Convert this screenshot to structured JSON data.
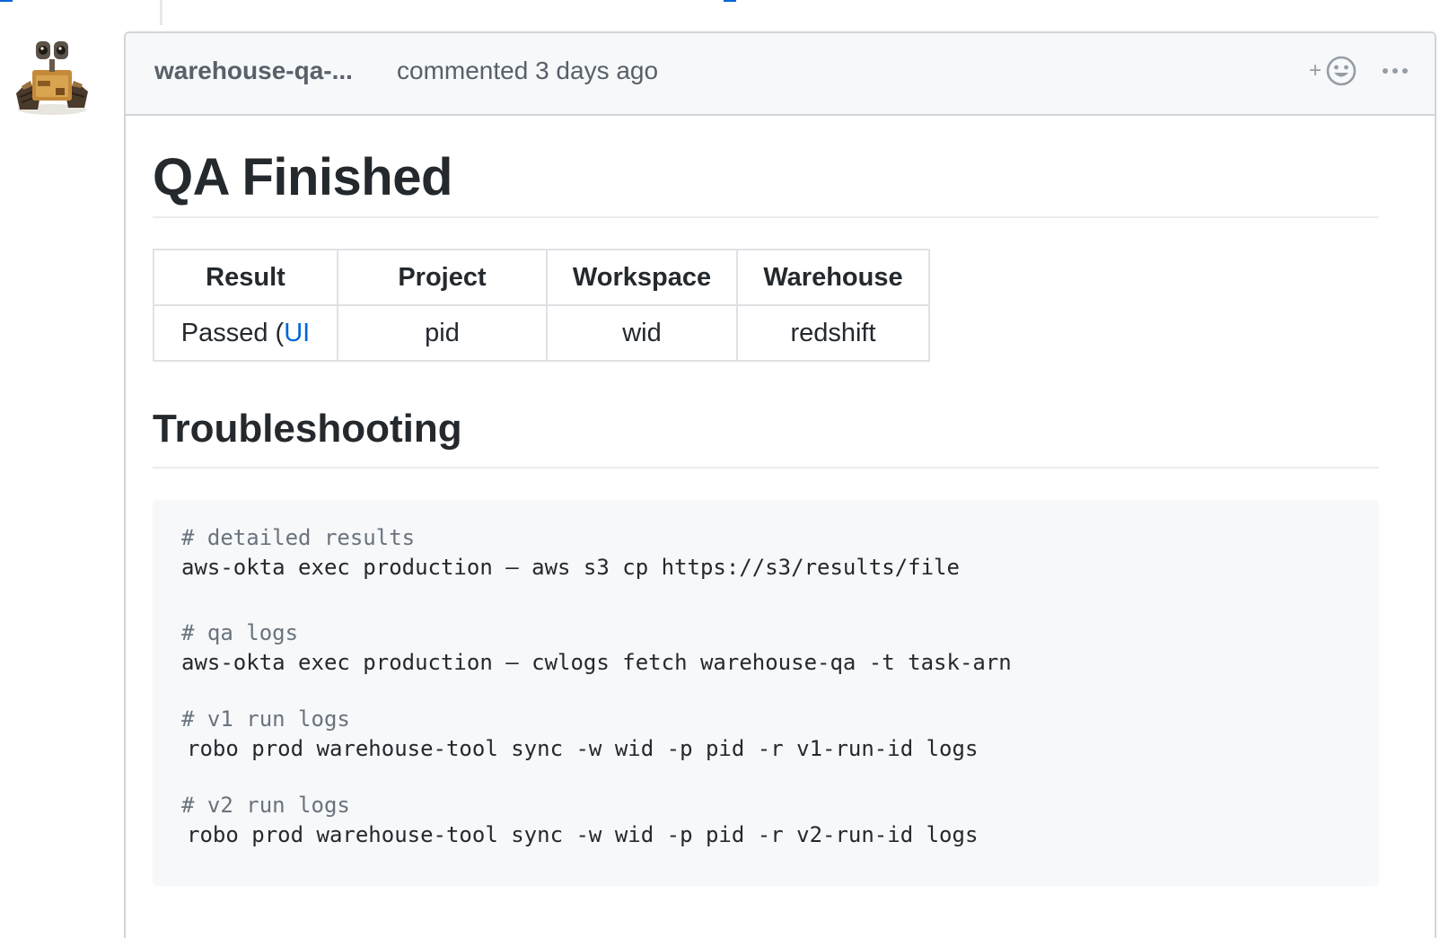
{
  "comment": {
    "author": "warehouse-qa-...",
    "timestamp": "commented 3 days ago",
    "reaction_icon": "smiley-icon",
    "reaction_plus": "+",
    "more_icon": "kebab-horizontal-icon"
  },
  "body": {
    "title": "QA Finished",
    "table": {
      "headers": [
        "Result",
        "Project",
        "Workspace",
        "Warehouse"
      ],
      "row": {
        "result_prefix": "Passed (",
        "result_link": "UI",
        "project": "pid",
        "workspace": "wid",
        "warehouse": "redshift"
      }
    },
    "section_title": "Troubleshooting",
    "code": {
      "blocks": [
        {
          "comment": "# detailed results",
          "command": "aws-okta exec production — aws s3 cp https://s3/results/file"
        },
        {
          "comment": "# qa logs",
          "command": "aws-okta exec production — cwlogs fetch warehouse-qa -t task-arn"
        },
        {
          "comment": "# v1 run logs",
          "command": "robo prod warehouse-tool sync -w wid -p pid -r v1-run-id logs"
        },
        {
          "comment": "# v2 run logs",
          "command": "robo prod warehouse-tool sync -w wid -p pid -r v2-run-id logs"
        }
      ]
    }
  },
  "colors": {
    "link": "#0366d6",
    "header_bg": "#f6f8fa",
    "border": "#d1d5da",
    "muted_text": "#586069",
    "code_bg": "#f6f8fa"
  }
}
